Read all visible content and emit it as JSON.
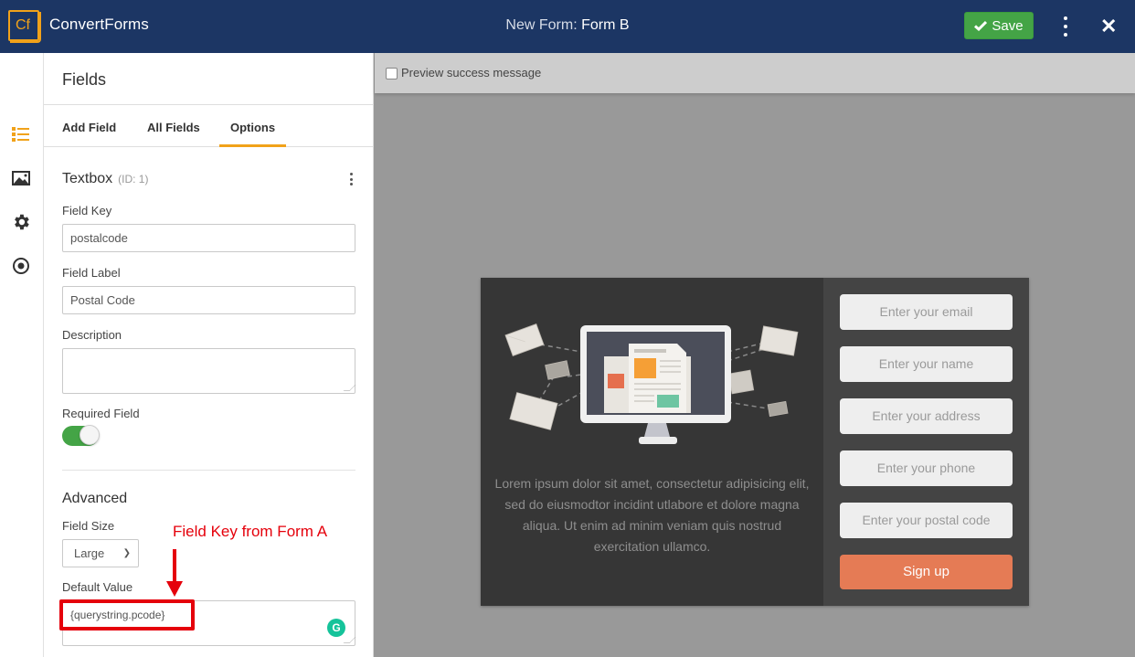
{
  "header": {
    "logo_text": "Cf",
    "brand": "ConvertForms",
    "title_prefix": "New Form:",
    "title_name": "Form B",
    "save_label": "Save"
  },
  "rail": {
    "items": [
      {
        "icon": "fields-list-icon",
        "active": true
      },
      {
        "icon": "image-icon",
        "active": false
      },
      {
        "icon": "gear-icon",
        "active": false
      },
      {
        "icon": "target-icon",
        "active": false
      }
    ]
  },
  "panel": {
    "title": "Fields",
    "tabs": [
      {
        "label": "Add Field",
        "active": false
      },
      {
        "label": "All Fields",
        "active": false
      },
      {
        "label": "Options",
        "active": true
      }
    ],
    "field_type": "Textbox",
    "field_id": "(ID: 1)",
    "field_key_label": "Field Key",
    "field_key_value": "postalcode",
    "field_label_label": "Field Label",
    "field_label_value": "Postal Code",
    "description_label": "Description",
    "description_value": "",
    "required_label": "Required Field",
    "required_on": true,
    "advanced_title": "Advanced",
    "field_size_label": "Field Size",
    "field_size_value": "Large",
    "default_value_label": "Default Value",
    "default_value": "{querystring.pcode}"
  },
  "annotation": {
    "text": "Field Key from Form A",
    "color": "#e5000b"
  },
  "preview": {
    "success_checkbox_label": "Preview success message",
    "success_checked": false,
    "lorem": "Lorem ipsum dolor sit amet, consectetur adipisicing elit, sed do eiusmodtor incidint utlabore et dolore magna aliqua. Ut enim ad minim veniam quis nostrud exercitation ullamco.",
    "inputs": [
      "Enter your email",
      "Enter your name",
      "Enter your address",
      "Enter your phone",
      "Enter your postal code"
    ],
    "submit_label": "Sign up",
    "submit_color": "#e57b55"
  },
  "colors": {
    "header_bg": "#1c3664",
    "accent": "#f1a21a",
    "save_green": "#44a446"
  }
}
